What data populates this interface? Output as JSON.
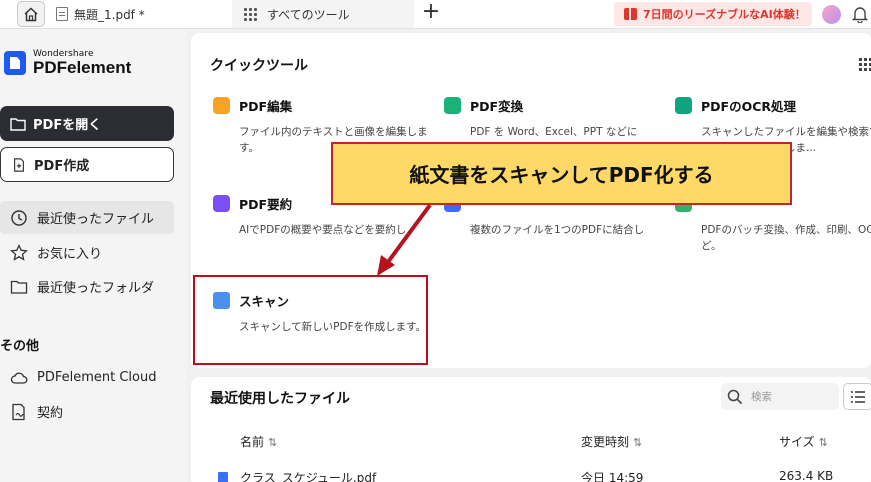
{
  "topbar": {
    "doc_tab": "無題_1.pdf *",
    "tools_tab": "すべてのツール",
    "new_tab": "+",
    "promo": "7日間のリーズナブルなAI体験！"
  },
  "sidebar": {
    "brand_small": "Wondershare",
    "brand_big": "PDFelement",
    "open_pdf": "PDFを開く",
    "create_pdf": "PDF作成",
    "nav": [
      {
        "label": "最近使ったファイル"
      },
      {
        "label": "お気に入り"
      },
      {
        "label": "最近使ったフォルダ"
      }
    ],
    "section_other": "その他",
    "other": [
      {
        "label": "PDFelement Cloud"
      },
      {
        "label": "契約"
      }
    ]
  },
  "quick": {
    "title": "クイックツール",
    "tools": [
      {
        "name": "PDF編集",
        "desc": "ファイル内のテキストと画像を編集します。",
        "color": "#f7a325"
      },
      {
        "name": "PDF変換",
        "desc": "PDF を Word、Excel、PPT などに",
        "color": "#19b37a"
      },
      {
        "name": "PDFのOCR処理",
        "desc": "スキャンしたファイルを編集や検索できるファイルに変換しま...",
        "color": "#10a37f"
      },
      {
        "name": "PDF要約",
        "desc": "AIでPDFの概要や要点などを要約し",
        "color": "#7a4ff3"
      },
      {
        "name": "",
        "desc": "複数のファイルを1つのPDFに結合し",
        "color": "#3b6ef5"
      },
      {
        "name": "",
        "desc": "PDFのバッチ変換、作成、印刷、OCRなど。",
        "color": "#2fb36a"
      },
      {
        "name": "スキャン",
        "desc": "スキャンして新しいPDFを作成します。",
        "color": "#4a90f0"
      }
    ]
  },
  "callout": {
    "text": "紙文書をスキャンしてPDF化する",
    "bg": "#fed968",
    "border": "#c0262a"
  },
  "recent": {
    "title": "最近使用したファイル",
    "search_placeholder": "検索",
    "columns": {
      "name": "名前",
      "modified": "変更時刻",
      "size": "サイズ"
    },
    "sort_glyph": "⇅",
    "rows": [
      {
        "name": "クラス_スケジュール.pdf",
        "modified": "今日 14:59",
        "size": "263.4 KB"
      }
    ]
  }
}
